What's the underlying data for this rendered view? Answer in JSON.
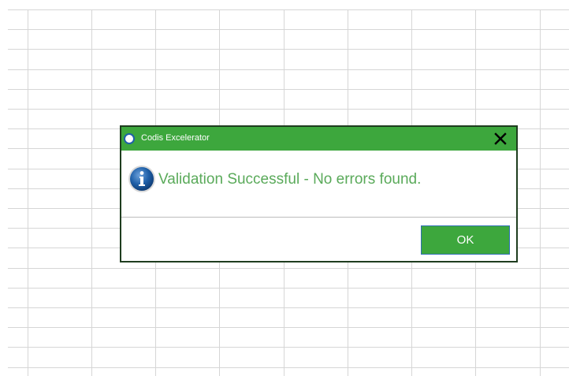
{
  "dialog": {
    "title": "Codis Excelerator",
    "message": "Validation Successful - No errors found.",
    "ok_label": "OK",
    "icon": "info-icon",
    "close_icon": "close-icon"
  },
  "colors": {
    "accent": "#3da73d",
    "message_text": "#5aaa5a",
    "info_icon": "#1e5fa8"
  }
}
